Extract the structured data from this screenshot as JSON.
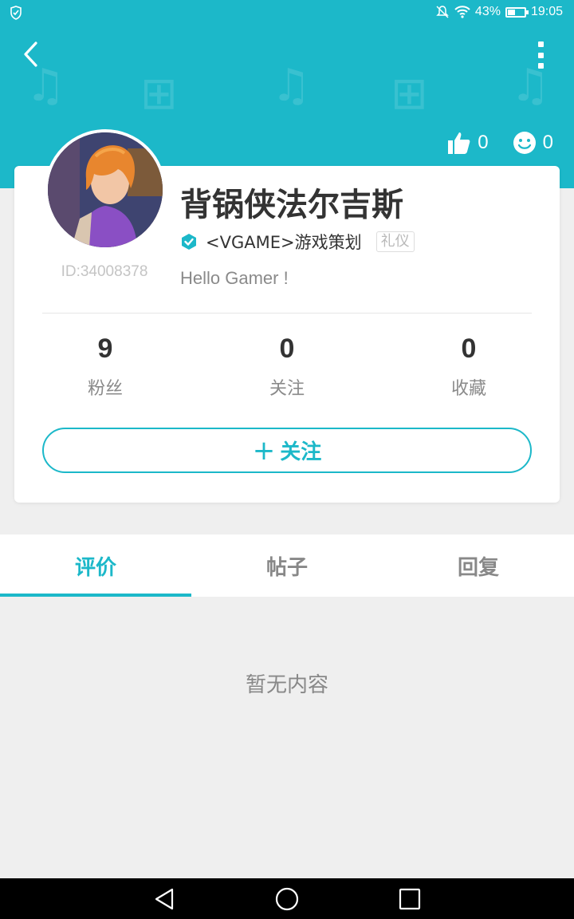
{
  "status_bar": {
    "battery_percent": "43%",
    "battery_level": 0.43,
    "time": "19:05"
  },
  "header": {
    "background_color": "#1cb8c9",
    "likes_count": "0",
    "smiles_count": "0"
  },
  "profile": {
    "name": "背锅侠法尔吉斯",
    "user_id": "ID:34008378",
    "role": "<VGAME>游戏策划",
    "tag": "礼仪",
    "bio": "Hello Gamer !"
  },
  "stats": [
    {
      "value": "9",
      "label": "粉丝"
    },
    {
      "value": "0",
      "label": "关注"
    },
    {
      "value": "0",
      "label": "收藏"
    }
  ],
  "follow_button": {
    "plus": "+",
    "label": "关注"
  },
  "tabs": [
    {
      "label": "评价",
      "active": true
    },
    {
      "label": "帖子",
      "active": false
    },
    {
      "label": "回复",
      "active": false
    }
  ],
  "empty_state": "暂无内容",
  "accent_color": "#1cb8c9"
}
